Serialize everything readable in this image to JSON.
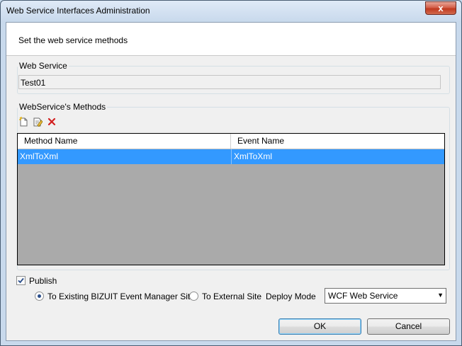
{
  "window": {
    "title": "Web Service Interfaces Administration",
    "close_glyph": "x"
  },
  "header": {
    "text": "Set the web service methods"
  },
  "web_service": {
    "group_label": "Web Service",
    "value": "Test01"
  },
  "methods": {
    "group_label": "WebService's Methods",
    "toolbar": {
      "new_icon": "new-document-icon",
      "edit_icon": "edit-icon",
      "delete_icon": "delete-icon"
    },
    "columns": [
      "Method Name",
      "Event Name"
    ],
    "rows": [
      {
        "method_name": "XmlToXml",
        "event_name": "XmlToXml",
        "selected": true
      }
    ]
  },
  "publish": {
    "label": "Publish",
    "checked": true,
    "option_existing": "To Existing BIZUIT Event Manager Site",
    "option_external": "To External Site",
    "selected_option": "existing",
    "deploy_mode_label": "Deploy Mode",
    "deploy_mode_value": "WCF Web Service"
  },
  "buttons": {
    "ok": "OK",
    "cancel": "Cancel"
  },
  "colors": {
    "selection": "#3399ff",
    "grid_background": "#aaaaaa",
    "close_button": "#c0391f"
  }
}
